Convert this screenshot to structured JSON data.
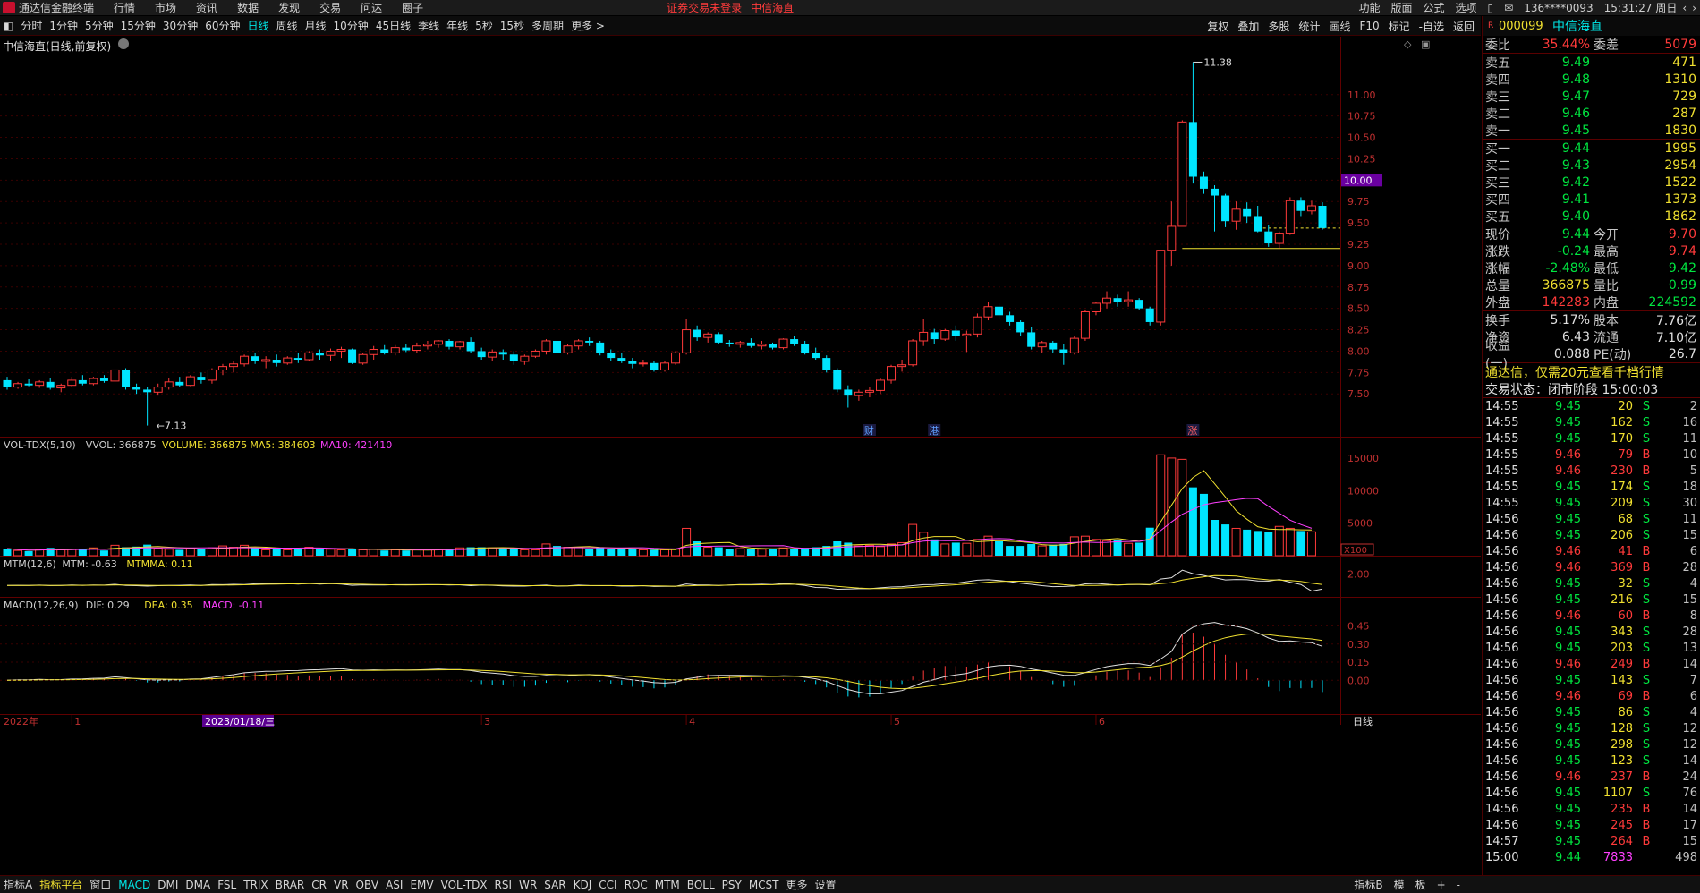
{
  "app": {
    "name": "通达信金融终端",
    "menu": [
      "行情",
      "市场",
      "资讯",
      "数据",
      "发现",
      "交易",
      "问达",
      "圈子"
    ],
    "warning": "证券交易未登录",
    "stock_title": "中信海直",
    "right_menu": [
      "功能",
      "版面",
      "公式",
      "选项"
    ],
    "account": "136****0093",
    "time": "15:31:27 周日"
  },
  "periods": [
    "分时",
    "1分钟",
    "5分钟",
    "15分钟",
    "30分钟",
    "60分钟",
    "日线",
    "周线",
    "月线",
    "10分钟",
    "45日线",
    "季线",
    "年线",
    "5秒",
    "15秒",
    "多周期",
    "更多 >"
  ],
  "active_period": "日线",
  "tools": [
    "复权",
    "叠加",
    "多股",
    "统计",
    "画线",
    "F10",
    "标记",
    "-自选",
    "返回"
  ],
  "chart_title": "中信海直(日线,前复权)",
  "price_labels": {
    "high": "11.38",
    "low": "7.13",
    "current": "10.00"
  },
  "event_marks": [
    "财",
    "港",
    "涨"
  ],
  "price_axis": [
    "11.00",
    "10.75",
    "10.50",
    "10.25",
    "10.00",
    "9.75",
    "9.50",
    "9.25",
    "9.00",
    "8.75",
    "8.50",
    "8.25",
    "8.00",
    "7.75",
    "7.50"
  ],
  "vol_axis": [
    "15000",
    "10000",
    "5000",
    "X100"
  ],
  "mtm_axis": [
    "2.00"
  ],
  "macd_axis": [
    "0.45",
    "0.30",
    "0.15",
    "0.00"
  ],
  "vol_legend": {
    "name": "VOL-TDX(5,10)",
    "vvol": "VVOL: 366875",
    "volume": "VOLUME: 366875",
    "ma5": "MA5: 384603",
    "ma10": "MA10: 421410"
  },
  "mtm_legend": {
    "name": "MTM(12,6)",
    "mtm": "MTM: -0.63",
    "mtmma": "MTMMA: 0.11"
  },
  "macd_legend": {
    "name": "MACD(12,26,9)",
    "dif": "DIF: 0.29",
    "dea": "DEA: 0.35",
    "macd": "MACD: -0.11"
  },
  "date_axis": {
    "year": "2022年",
    "m1": "1",
    "date": "2023/01/18/三",
    "m3": "3",
    "m4": "4",
    "m5": "5",
    "m6": "6",
    "period": "日线"
  },
  "indicators": [
    "指标A",
    "指标平台",
    "窗口",
    "MACD",
    "DMI",
    "DMA",
    "FSL",
    "TRIX",
    "BRAR",
    "CR",
    "VR",
    "OBV",
    "ASI",
    "EMV",
    "VOL-TDX",
    "RSI",
    "WR",
    "SAR",
    "KDJ",
    "CCI",
    "ROC",
    "MTM",
    "BOLL",
    "PSY",
    "MCST",
    "更多",
    "设置"
  ],
  "active_indicator": "MACD",
  "bottom_right": [
    "指标B",
    "模",
    "板",
    "+",
    "-"
  ],
  "quote": {
    "code": "000099",
    "name": "中信海直",
    "weibi_label": "委比",
    "weibi": "35.44%",
    "weicha_label": "委差",
    "weicha": "5079",
    "asks": [
      {
        "l": "卖五",
        "p": "9.49",
        "v": "471"
      },
      {
        "l": "卖四",
        "p": "9.48",
        "v": "1310"
      },
      {
        "l": "卖三",
        "p": "9.47",
        "v": "729"
      },
      {
        "l": "卖二",
        "p": "9.46",
        "v": "287"
      },
      {
        "l": "卖一",
        "p": "9.45",
        "v": "1830"
      }
    ],
    "bids": [
      {
        "l": "买一",
        "p": "9.44",
        "v": "1995"
      },
      {
        "l": "买二",
        "p": "9.43",
        "v": "2954"
      },
      {
        "l": "买三",
        "p": "9.42",
        "v": "1522"
      },
      {
        "l": "买四",
        "p": "9.41",
        "v": "1373"
      },
      {
        "l": "买五",
        "p": "9.40",
        "v": "1862"
      }
    ],
    "stats1": [
      {
        "l": "现价",
        "v": "9.44",
        "c": "green",
        "l2": "今开",
        "v2": "9.70",
        "c2": "red"
      },
      {
        "l": "涨跌",
        "v": "-0.24",
        "c": "green",
        "l2": "最高",
        "v2": "9.74",
        "c2": "red"
      },
      {
        "l": "涨幅",
        "v": "-2.48%",
        "c": "green",
        "l2": "最低",
        "v2": "9.42",
        "c2": "green"
      },
      {
        "l": "总量",
        "v": "366875",
        "c": "yellow",
        "l2": "量比",
        "v2": "0.99",
        "c2": "green"
      },
      {
        "l": "外盘",
        "v": "142283",
        "c": "red",
        "l2": "内盘",
        "v2": "224592",
        "c2": "green"
      }
    ],
    "stats2": [
      {
        "l": "换手",
        "v": "5.17%",
        "l2": "股本",
        "v2": "7.76亿"
      },
      {
        "l": "净资",
        "v": "6.43",
        "l2": "流通",
        "v2": "7.10亿"
      },
      {
        "l": "收益(一)",
        "v": "0.088",
        "l2": "PE(动)",
        "v2": "26.7"
      }
    ],
    "ad": "通达信，仅需20元查看千档行情",
    "status": "交易状态：闭市阶段 15:00:03",
    "ticks": [
      [
        "14:55",
        "9.45",
        "20",
        "S",
        "2"
      ],
      [
        "14:55",
        "9.45",
        "162",
        "S",
        "16"
      ],
      [
        "14:55",
        "9.45",
        "170",
        "S",
        "11"
      ],
      [
        "14:55",
        "9.46",
        "79",
        "B",
        "10"
      ],
      [
        "14:55",
        "9.46",
        "230",
        "B",
        "5"
      ],
      [
        "14:55",
        "9.45",
        "174",
        "S",
        "18"
      ],
      [
        "14:55",
        "9.45",
        "209",
        "S",
        "30"
      ],
      [
        "14:56",
        "9.45",
        "68",
        "S",
        "11"
      ],
      [
        "14:56",
        "9.45",
        "206",
        "S",
        "15"
      ],
      [
        "14:56",
        "9.46",
        "41",
        "B",
        "6"
      ],
      [
        "14:56",
        "9.46",
        "369",
        "B",
        "28"
      ],
      [
        "14:56",
        "9.45",
        "32",
        "S",
        "4"
      ],
      [
        "14:56",
        "9.45",
        "216",
        "S",
        "15"
      ],
      [
        "14:56",
        "9.46",
        "60",
        "B",
        "8"
      ],
      [
        "14:56",
        "9.45",
        "343",
        "S",
        "28"
      ],
      [
        "14:56",
        "9.45",
        "203",
        "S",
        "13"
      ],
      [
        "14:56",
        "9.46",
        "249",
        "B",
        "14"
      ],
      [
        "14:56",
        "9.45",
        "143",
        "S",
        "7"
      ],
      [
        "14:56",
        "9.46",
        "69",
        "B",
        "6"
      ],
      [
        "14:56",
        "9.45",
        "86",
        "S",
        "4"
      ],
      [
        "14:56",
        "9.45",
        "128",
        "S",
        "12"
      ],
      [
        "14:56",
        "9.45",
        "298",
        "S",
        "12"
      ],
      [
        "14:56",
        "9.45",
        "123",
        "S",
        "14"
      ],
      [
        "14:56",
        "9.46",
        "237",
        "B",
        "24"
      ],
      [
        "14:56",
        "9.45",
        "1107",
        "S",
        "76"
      ],
      [
        "14:56",
        "9.45",
        "235",
        "B",
        "14"
      ],
      [
        "14:56",
        "9.45",
        "245",
        "B",
        "17"
      ],
      [
        "14:57",
        "9.45",
        "264",
        "B",
        "15"
      ],
      [
        "15:00",
        "9.44",
        "7833",
        "",
        "498"
      ]
    ]
  },
  "chart_data": {
    "type": "candlestick",
    "note": "daily candles, OHLC",
    "ohlc": [
      [
        7.66,
        7.7,
        7.55,
        7.58
      ],
      [
        7.58,
        7.64,
        7.56,
        7.62
      ],
      [
        7.62,
        7.67,
        7.59,
        7.6
      ],
      [
        7.6,
        7.66,
        7.57,
        7.64
      ],
      [
        7.64,
        7.69,
        7.55,
        7.57
      ],
      [
        7.57,
        7.62,
        7.52,
        7.6
      ],
      [
        7.6,
        7.7,
        7.58,
        7.66
      ],
      [
        7.66,
        7.72,
        7.6,
        7.62
      ],
      [
        7.62,
        7.7,
        7.6,
        7.68
      ],
      [
        7.68,
        7.72,
        7.63,
        7.65
      ],
      [
        7.65,
        7.82,
        7.62,
        7.78
      ],
      [
        7.78,
        7.8,
        7.55,
        7.58
      ],
      [
        7.58,
        7.62,
        7.5,
        7.55
      ],
      [
        7.55,
        7.58,
        7.13,
        7.52
      ],
      [
        7.52,
        7.62,
        7.48,
        7.58
      ],
      [
        7.58,
        7.68,
        7.55,
        7.64
      ],
      [
        7.64,
        7.7,
        7.58,
        7.6
      ],
      [
        7.6,
        7.72,
        7.59,
        7.7
      ],
      [
        7.7,
        7.75,
        7.62,
        7.66
      ],
      [
        7.66,
        7.8,
        7.62,
        7.78
      ],
      [
        7.78,
        7.85,
        7.72,
        7.82
      ],
      [
        7.82,
        7.88,
        7.75,
        7.85
      ],
      [
        7.85,
        7.96,
        7.82,
        7.94
      ],
      [
        7.94,
        7.98,
        7.85,
        7.88
      ],
      [
        7.88,
        7.94,
        7.8,
        7.9
      ],
      [
        7.9,
        7.96,
        7.82,
        7.86
      ],
      [
        7.86,
        7.94,
        7.84,
        7.92
      ],
      [
        7.92,
        7.98,
        7.86,
        7.9
      ],
      [
        7.9,
        8.0,
        7.88,
        7.98
      ],
      [
        7.98,
        8.02,
        7.9,
        7.95
      ],
      [
        7.95,
        8.03,
        7.88,
        8.0
      ],
      [
        8.0,
        8.05,
        7.92,
        8.02
      ],
      [
        8.02,
        8.03,
        7.85,
        7.86
      ],
      [
        7.86,
        7.98,
        7.84,
        7.96
      ],
      [
        7.96,
        8.06,
        7.9,
        8.02
      ],
      [
        8.02,
        8.07,
        7.96,
        7.98
      ],
      [
        7.98,
        8.07,
        7.95,
        8.04
      ],
      [
        8.04,
        8.08,
        7.99,
        8.01
      ],
      [
        8.01,
        8.1,
        7.98,
        8.06
      ],
      [
        8.06,
        8.12,
        8.02,
        8.08
      ],
      [
        8.08,
        8.13,
        8.04,
        8.12
      ],
      [
        8.12,
        8.14,
        8.02,
        8.05
      ],
      [
        8.05,
        8.12,
        8.02,
        8.11
      ],
      [
        8.11,
        8.16,
        7.98,
        8.0
      ],
      [
        8.0,
        8.04,
        7.9,
        7.93
      ],
      [
        7.93,
        8.02,
        7.88,
        7.99
      ],
      [
        7.99,
        8.02,
        7.9,
        7.96
      ],
      [
        7.96,
        8.0,
        7.84,
        7.88
      ],
      [
        7.88,
        7.96,
        7.84,
        7.94
      ],
      [
        7.94,
        8.02,
        7.92,
        8.0
      ],
      [
        8.0,
        8.14,
        7.96,
        8.12
      ],
      [
        8.12,
        8.16,
        7.94,
        7.98
      ],
      [
        7.98,
        8.08,
        7.96,
        8.06
      ],
      [
        8.06,
        8.14,
        8.02,
        8.12
      ],
      [
        8.12,
        8.16,
        8.06,
        8.1
      ],
      [
        8.1,
        8.12,
        7.95,
        7.98
      ],
      [
        7.98,
        8.02,
        7.88,
        7.92
      ],
      [
        7.92,
        7.98,
        7.86,
        7.88
      ],
      [
        7.88,
        7.92,
        7.8,
        7.85
      ],
      [
        7.85,
        7.9,
        7.82,
        7.86
      ],
      [
        7.86,
        7.88,
        7.76,
        7.78
      ],
      [
        7.78,
        7.88,
        7.76,
        7.86
      ],
      [
        7.86,
        8.0,
        7.84,
        7.98
      ],
      [
        7.98,
        8.38,
        7.96,
        8.25
      ],
      [
        8.25,
        8.3,
        8.12,
        8.16
      ],
      [
        8.16,
        8.22,
        8.1,
        8.2
      ],
      [
        8.2,
        8.22,
        8.08,
        8.1
      ],
      [
        8.1,
        8.13,
        8.05,
        8.08
      ],
      [
        8.08,
        8.12,
        8.04,
        8.1
      ],
      [
        8.1,
        8.15,
        8.04,
        8.06
      ],
      [
        8.06,
        8.12,
        8.02,
        8.08
      ],
      [
        8.08,
        8.1,
        8.02,
        8.04
      ],
      [
        8.04,
        8.15,
        8.02,
        8.14
      ],
      [
        8.14,
        8.18,
        8.06,
        8.08
      ],
      [
        8.08,
        8.12,
        7.96,
        7.98
      ],
      [
        7.98,
        8.04,
        7.9,
        7.92
      ],
      [
        7.92,
        7.95,
        7.75,
        7.78
      ],
      [
        7.78,
        7.8,
        7.52,
        7.55
      ],
      [
        7.55,
        7.6,
        7.34,
        7.48
      ],
      [
        7.48,
        7.55,
        7.42,
        7.52
      ],
      [
        7.52,
        7.58,
        7.46,
        7.54
      ],
      [
        7.54,
        7.68,
        7.5,
        7.66
      ],
      [
        7.66,
        7.84,
        7.62,
        7.82
      ],
      [
        7.82,
        7.9,
        7.76,
        7.84
      ],
      [
        7.84,
        8.14,
        7.82,
        8.12
      ],
      [
        8.12,
        8.38,
        8.06,
        8.22
      ],
      [
        8.22,
        8.26,
        8.08,
        8.14
      ],
      [
        8.14,
        8.26,
        8.12,
        8.24
      ],
      [
        8.24,
        8.3,
        8.12,
        8.18
      ],
      [
        8.18,
        8.24,
        7.99,
        8.2
      ],
      [
        8.2,
        8.44,
        8.16,
        8.4
      ],
      [
        8.4,
        8.58,
        8.36,
        8.52
      ],
      [
        8.52,
        8.56,
        8.38,
        8.42
      ],
      [
        8.42,
        8.46,
        8.3,
        8.34
      ],
      [
        8.34,
        8.36,
        8.18,
        8.22
      ],
      [
        8.22,
        8.28,
        8.02,
        8.05
      ],
      [
        8.05,
        8.12,
        7.98,
        8.1
      ],
      [
        8.1,
        8.12,
        7.98,
        8.02
      ],
      [
        8.02,
        8.08,
        7.84,
        7.98
      ],
      [
        7.98,
        8.18,
        7.96,
        8.15
      ],
      [
        8.15,
        8.48,
        8.12,
        8.46
      ],
      [
        8.46,
        8.58,
        8.42,
        8.56
      ],
      [
        8.56,
        8.7,
        8.5,
        8.62
      ],
      [
        8.62,
        8.66,
        8.52,
        8.58
      ],
      [
        8.58,
        8.7,
        8.52,
        8.6
      ],
      [
        8.6,
        8.62,
        8.48,
        8.5
      ],
      [
        8.5,
        8.52,
        8.3,
        8.34
      ],
      [
        8.34,
        9.18,
        8.3,
        9.18
      ],
      [
        9.18,
        9.75,
        9.0,
        9.46
      ],
      [
        9.46,
        10.7,
        9.46,
        10.68
      ],
      [
        10.68,
        11.38,
        9.96,
        10.04
      ],
      [
        10.04,
        10.1,
        9.84,
        9.9
      ],
      [
        9.9,
        9.94,
        9.4,
        9.82
      ],
      [
        9.82,
        9.84,
        9.45,
        9.52
      ],
      [
        9.52,
        9.75,
        9.42,
        9.66
      ],
      [
        9.66,
        9.74,
        9.5,
        9.58
      ],
      [
        9.58,
        9.7,
        9.39,
        9.4
      ],
      [
        9.4,
        9.48,
        9.22,
        9.26
      ],
      [
        9.26,
        9.4,
        9.2,
        9.38
      ],
      [
        9.38,
        9.8,
        9.36,
        9.76
      ],
      [
        9.76,
        9.8,
        9.58,
        9.64
      ],
      [
        9.64,
        9.76,
        9.6,
        9.7
      ],
      [
        9.7,
        9.74,
        9.42,
        9.44
      ]
    ],
    "volume": [
      1100,
      800,
      700,
      900,
      1200,
      900,
      1000,
      1100,
      1200,
      800,
      1600,
      1300,
      1400,
      1700,
      1100,
      1000,
      900,
      1100,
      1000,
      1200,
      1500,
      1300,
      1600,
      1200,
      900,
      1000,
      900,
      1100,
      1300,
      1000,
      1000,
      900,
      1100,
      900,
      1000,
      800,
      900,
      800,
      900,
      900,
      1000,
      1100,
      1200,
      1300,
      1300,
      1200,
      1200,
      1000,
      900,
      900,
      1800,
      1500,
      1300,
      1300,
      1100,
      1200,
      1100,
      1000,
      1000,
      900,
      900,
      900,
      1000,
      4200,
      2200,
      1300,
      1300,
      1100,
      1100,
      1100,
      1000,
      1000,
      1200,
      1100,
      1200,
      1300,
      1500,
      2200,
      2000,
      1500,
      1600,
      1400,
      1800,
      2000,
      4800,
      3600,
      2500,
      1800,
      2000,
      1900,
      2500,
      3000,
      2200,
      1500,
      1500,
      1800,
      1500,
      1700,
      1800,
      2900,
      3000,
      2500,
      2300,
      2400,
      1900,
      2000,
      4300,
      15500,
      15000,
      14800,
      10500,
      9500,
      5500,
      4800,
      4200,
      4000,
      3800,
      3600,
      4500,
      4200,
      3800,
      3668
    ],
    "event_marks": [
      {
        "i": 80,
        "t": "财"
      },
      {
        "i": 86,
        "t": "港"
      },
      {
        "i": 110,
        "t": "涨"
      }
    ],
    "volume_axis": [
      "15000",
      "10000",
      "5000",
      "X100"
    ],
    "mtm_axis": [
      "2.00"
    ],
    "macd_axis": [
      "0.45",
      "0.30",
      "0.15",
      "0.00"
    ],
    "price_ylim": [
      7.0,
      11.5
    ],
    "volume_ylim": [
      0,
      16500
    ],
    "mtm_ylim": [
      -1.5,
      3.0
    ],
    "macd_ylim": [
      -0.25,
      0.58
    ],
    "series_labels": [
      "VOL-TDX(5,10)",
      "MTM(12,6)",
      "MACD(12,26,9)"
    ]
  }
}
